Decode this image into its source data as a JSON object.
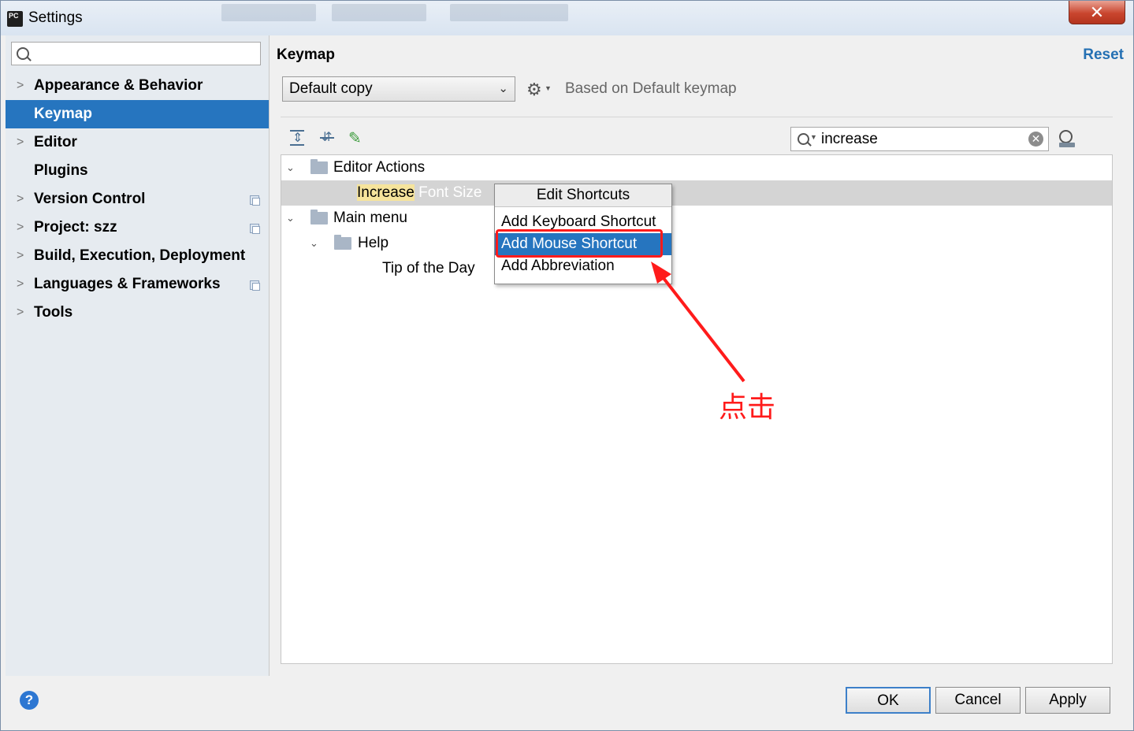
{
  "window": {
    "title": "Settings",
    "close_glyph": "✕",
    "app_icon_text": "PC"
  },
  "sidebar": {
    "search_placeholder": "",
    "items": [
      {
        "label": "Appearance & Behavior",
        "expandable": true
      },
      {
        "label": "Keymap",
        "expandable": false,
        "selected": true
      },
      {
        "label": "Editor",
        "expandable": true
      },
      {
        "label": "Plugins",
        "expandable": false
      },
      {
        "label": "Version Control",
        "expandable": true,
        "project_icon": true
      },
      {
        "label": "Project: szz",
        "expandable": true,
        "project_icon": true
      },
      {
        "label": "Build, Execution, Deployment",
        "expandable": true
      },
      {
        "label": "Languages & Frameworks",
        "expandable": true,
        "project_icon": true
      },
      {
        "label": "Tools",
        "expandable": true
      }
    ]
  },
  "main": {
    "title": "Keymap",
    "reset_label": "Reset",
    "keymap_select": "Default copy",
    "based_on": "Based on Default keymap",
    "filter_value": "increase",
    "tree": {
      "editor_actions": "Editor Actions",
      "increase_match": "Increase",
      "increase_rest": " Font Size",
      "main_menu": "Main menu",
      "help": "Help",
      "tip_of_day": "Tip of the Day"
    }
  },
  "context_menu": {
    "header": "Edit Shortcuts",
    "items": [
      "Add Keyboard Shortcut",
      "Add Mouse Shortcut",
      "Add Abbreviation"
    ],
    "selected_index": 1
  },
  "annotation": {
    "text": "点击",
    "color": "#ff1b1b"
  },
  "footer": {
    "ok": "OK",
    "cancel": "Cancel",
    "apply": "Apply",
    "help_glyph": "?"
  },
  "colors": {
    "selection": "#2675bf",
    "link": "#2470b3",
    "match_highlight": "#f6e49c"
  }
}
